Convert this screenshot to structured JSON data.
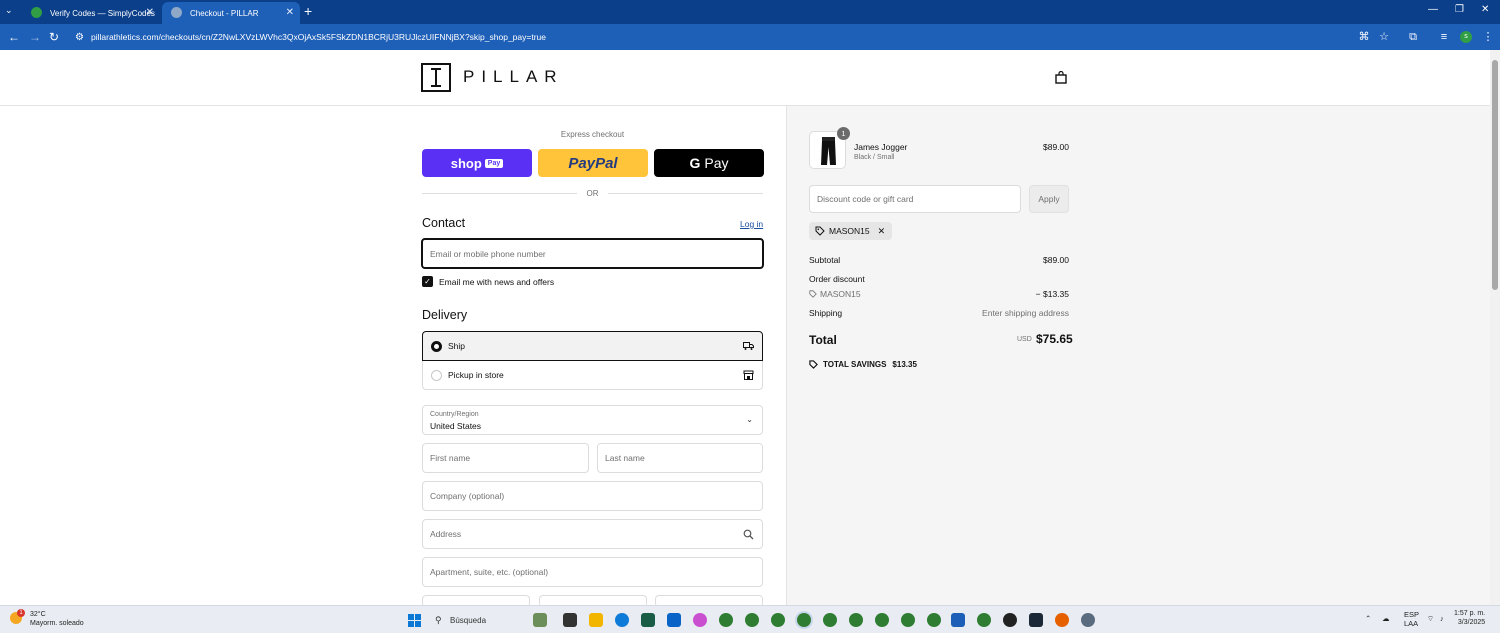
{
  "browser": {
    "tabs": [
      {
        "title": "Verify Codes — SimplyCodes",
        "active": false
      },
      {
        "title": "Checkout - PILLAR",
        "active": true
      }
    ],
    "url": "pillarathletics.com/checkouts/cn/Z2NwLXVzLWVhc3QxOjAxSk5FSkZDN1BCRjU3RUJlczUIFNNjBX?skip_shop_pay=true",
    "profile_initial": "s"
  },
  "header": {
    "brand": "PILLAR",
    "cart_icon": "shopping-bag-icon"
  },
  "express": {
    "title": "Express checkout",
    "shop_pay": "shop",
    "shop_pay_tag": "Pay",
    "paypal": "PayPal",
    "gpay": "Pay",
    "or": "OR"
  },
  "contact": {
    "heading": "Contact",
    "login": "Log in",
    "email_placeholder": "Email or mobile phone number",
    "newsletter_label": "Email me with news and offers",
    "newsletter_checked": true
  },
  "delivery": {
    "heading": "Delivery",
    "options": [
      {
        "label": "Ship",
        "selected": true,
        "icon": "truck-icon"
      },
      {
        "label": "Pickup in store",
        "selected": false,
        "icon": "store-icon"
      }
    ],
    "country_label": "Country/Region",
    "country_value": "United States",
    "first_name": "First name",
    "last_name": "Last name",
    "company": "Company (optional)",
    "address": "Address",
    "apartment": "Apartment, suite, etc. (optional)"
  },
  "order": {
    "item": {
      "name": "James Jogger",
      "variant": "Black / Small",
      "price": "$89.00",
      "quantity": "1"
    },
    "discount_placeholder": "Discount code or gift card",
    "apply": "Apply",
    "applied_code": "MASON15",
    "subtotal_label": "Subtotal",
    "subtotal": "$89.00",
    "order_discount_label": "Order discount",
    "discount_code": "MASON15",
    "discount_amount": "− $13.35",
    "shipping_label": "Shipping",
    "shipping_value": "Enter shipping address",
    "total_label": "Total",
    "currency": "USD",
    "total": "$75.65",
    "savings_label": "TOTAL SAVINGS",
    "savings": "$13.35"
  },
  "taskbar": {
    "temp": "32°C",
    "weather": "Mayorm. soleado",
    "weather_badge": "1",
    "search": "Búsqueda",
    "lang1": "ESP",
    "lang2": "LAA",
    "time": "1:57 p. m.",
    "date": "3/3/2025"
  },
  "colors": {
    "tabbar": "#0b3f8a",
    "addressbar": "#1e5fb8",
    "shop_pay": "#5a31f4",
    "paypal": "#ffc439",
    "gpay": "#000000"
  }
}
